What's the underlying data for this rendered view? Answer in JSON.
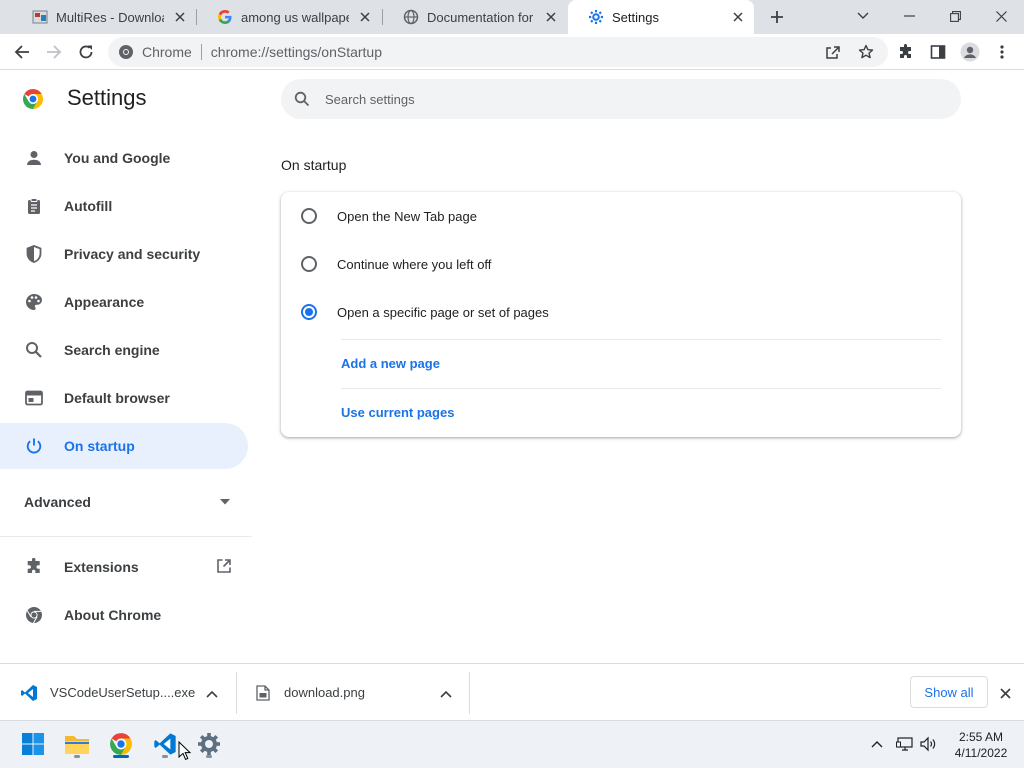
{
  "tabs": [
    {
      "title": "MultiRes - Download",
      "favicon": "multires-favicon"
    },
    {
      "title": "among us wallpaper - G",
      "favicon": "google-g-icon"
    },
    {
      "title": "Documentation for Vis",
      "favicon": "globe-icon"
    },
    {
      "title": "Settings",
      "favicon": "gear-icon",
      "active": true
    }
  ],
  "toolbar": {
    "site_label": "Chrome",
    "url": "chrome://settings/onStartup"
  },
  "settings": {
    "title": "Settings",
    "search_placeholder": "Search settings"
  },
  "sidebar": {
    "items": [
      {
        "label": "You and Google",
        "icon": "person-icon"
      },
      {
        "label": "Autofill",
        "icon": "clipboard-icon"
      },
      {
        "label": "Privacy and security",
        "icon": "shield-icon"
      },
      {
        "label": "Appearance",
        "icon": "palette-icon"
      },
      {
        "label": "Search engine",
        "icon": "search-icon"
      },
      {
        "label": "Default browser",
        "icon": "browser-window-icon"
      },
      {
        "label": "On startup",
        "icon": "power-icon",
        "active": true
      }
    ],
    "advanced_label": "Advanced",
    "extensions_label": "Extensions",
    "about_label": "About Chrome"
  },
  "startup": {
    "section_title": "On startup",
    "options": [
      {
        "label": "Open the New Tab page",
        "checked": false
      },
      {
        "label": "Continue where you left off",
        "checked": false
      },
      {
        "label": "Open a specific page or set of pages",
        "checked": true
      }
    ],
    "add_page_label": "Add a new page",
    "use_current_label": "Use current pages"
  },
  "downloads": {
    "items": [
      {
        "name": "VSCodeUserSetup....exe",
        "icon": "vscode-icon"
      },
      {
        "name": "download.png",
        "icon": "file-icon"
      }
    ],
    "show_all_label": "Show all"
  },
  "taskbar": {
    "apps": [
      "windows-start-icon",
      "file-explorer-icon",
      "chrome-icon",
      "vscode-icon",
      "settings-gear-icon"
    ],
    "time": "2:55 AM",
    "date": "4/11/2022"
  },
  "colors": {
    "accent": "#1a73e8",
    "nav_active_bg": "#e8f0fe",
    "tabstrip_bg": "#dee1e6"
  }
}
